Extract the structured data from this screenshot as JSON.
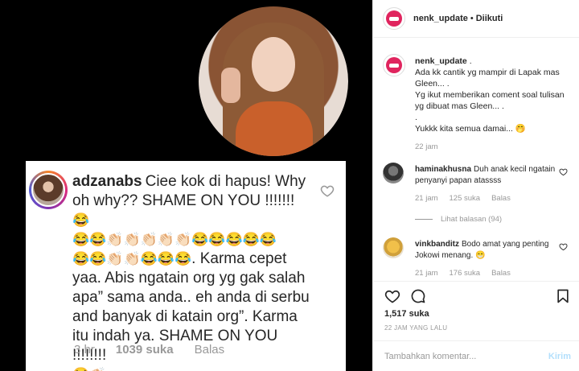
{
  "post_image": {
    "comment": {
      "username": "adzanabs",
      "text_a": "Ciee kok di hapus! Why oh why?? SHAME ON YOU !!!!!!!",
      "emoji_line_1": "😂",
      "emoji_line_2": "😂😂👏🏻👏🏻👏🏻👏🏻👏🏻😂😂😂😂😂",
      "emoji_line_3": "😂😂👏🏻👏🏻😂😂😂",
      "text_b": ". Karma cepet yaa. Abis ngatain org yg gak salah apa” sama anda.. eh anda di serbu and banyak di katain org”. Karma itu indah ya. SHAME ON YOU !!!!!!!!",
      "emoji_line_4": "😂👏🏻",
      "time": "3 hr",
      "likes": "1039 suka",
      "reply": "Balas"
    }
  },
  "sidebar": {
    "header": {
      "username": "nenk_update",
      "separator": "•",
      "follow_status": "Diikuti"
    },
    "caption": {
      "username": "nenk_update",
      "text": ".\nAda kk cantik yg mampir di Lapak mas Gleen... .\nYg ikut memberikan coment soal tulisan yg dibuat mas Gleen... .\n.\nYukkk kita semua damai... 🤭",
      "time": "22 jam"
    },
    "comments": [
      {
        "username": "haminakhusna",
        "text": "Duh anak kecil ngatain penyanyi papan atassss",
        "time": "21 jam",
        "likes": "125 suka",
        "reply": "Balas",
        "view_replies": "Lihat balasan (94)"
      },
      {
        "username": "vinkbanditz",
        "text": "Bodo amat yang penting Jokowi menang. 😁",
        "time": "21 jam",
        "likes": "176 suka",
        "reply": "Balas"
      }
    ],
    "likes": {
      "count": "1,517",
      "label": "suka"
    },
    "date": "22 JAM YANG LALU",
    "input": {
      "placeholder": "Tambahkan komentar...",
      "send": "Kirim"
    }
  },
  "colors": {
    "post_background": "#000000",
    "brand_avatar": "#e0245e",
    "send_disabled": "#b2dffc",
    "muted_text": "#999999"
  },
  "icons": [
    "heart-icon",
    "comment-icon",
    "save-bookmark-icon"
  ]
}
